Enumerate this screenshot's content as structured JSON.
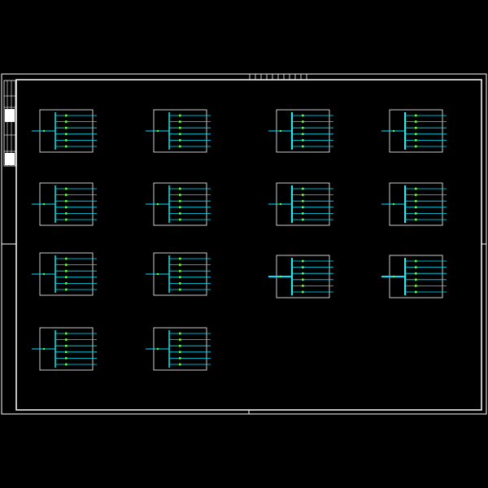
{
  "drawing": {
    "colors": {
      "background": "#000000",
      "frame": "#ffffff",
      "bus": "#00ffff",
      "feeder": "#00e5ff",
      "breaker": "#66ff33",
      "panel": "#ffffff"
    },
    "grid": {
      "rows": 4,
      "cols": 4
    },
    "panels": [
      {
        "id": "p-1-1",
        "row": 1,
        "col": 1,
        "feeders": 6
      },
      {
        "id": "p-1-2",
        "row": 1,
        "col": 2,
        "feeders": 6
      },
      {
        "id": "p-1-3",
        "row": 1,
        "col": 3,
        "feeders": 6
      },
      {
        "id": "p-1-4",
        "row": 1,
        "col": 4,
        "feeders": 6
      },
      {
        "id": "p-2-1",
        "row": 2,
        "col": 1,
        "feeders": 6
      },
      {
        "id": "p-2-2",
        "row": 2,
        "col": 2,
        "feeders": 6
      },
      {
        "id": "p-2-3",
        "row": 2,
        "col": 3,
        "feeders": 6
      },
      {
        "id": "p-2-4",
        "row": 2,
        "col": 4,
        "feeders": 6
      },
      {
        "id": "p-3-1",
        "row": 3,
        "col": 1,
        "feeders": 6
      },
      {
        "id": "p-3-2",
        "row": 3,
        "col": 2,
        "feeders": 6
      },
      {
        "id": "p-3-3",
        "row": 3,
        "col": 3,
        "feeders": 6
      },
      {
        "id": "p-3-4",
        "row": 3,
        "col": 4,
        "feeders": 6
      },
      {
        "id": "p-4-1",
        "row": 4,
        "col": 1,
        "feeders": 6
      },
      {
        "id": "p-4-2",
        "row": 4,
        "col": 2,
        "feeders": 6
      }
    ]
  }
}
